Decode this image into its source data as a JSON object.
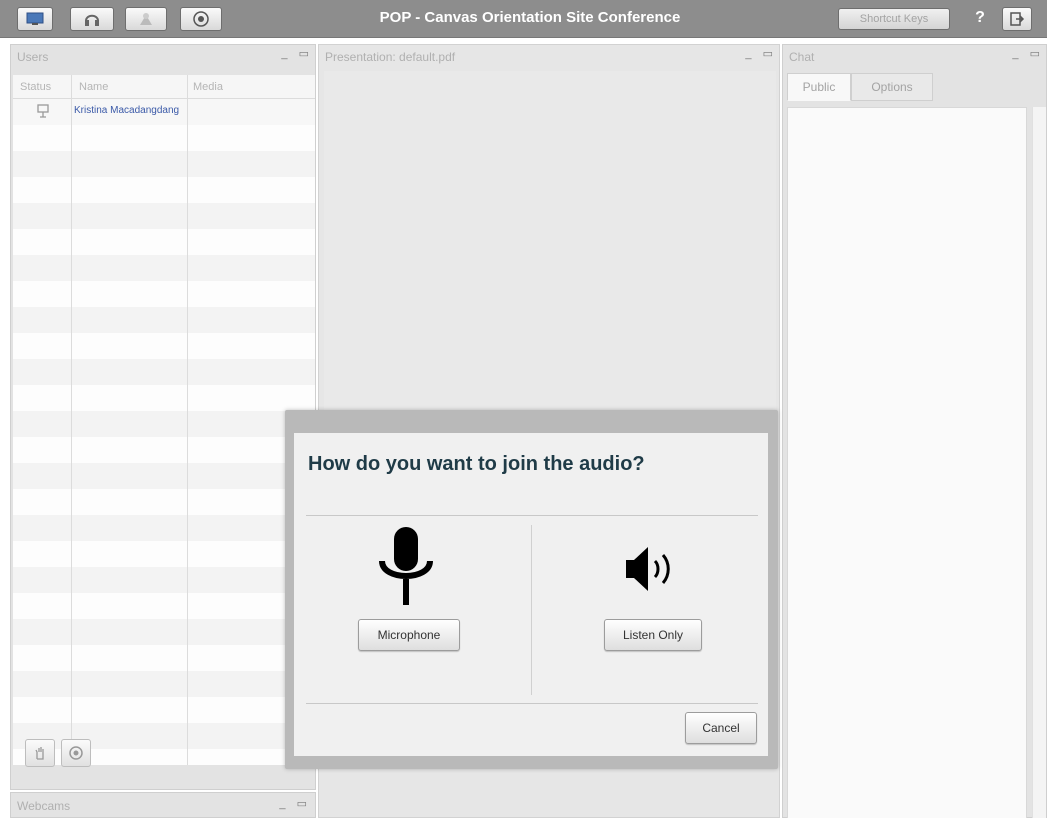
{
  "topbar": {
    "title": "POP - Canvas Orientation Site Conference",
    "shortcut_label": "Shortcut Keys",
    "help_label": "?",
    "icons": [
      "desktop-icon",
      "headset-icon",
      "webcam-icon",
      "record-icon"
    ]
  },
  "users": {
    "title": "Users",
    "columns": [
      "Status",
      "Name",
      "Media"
    ],
    "rows": [
      {
        "status_icon": "presenter-icon",
        "name": "Kristina Macadangdang",
        "media": ""
      }
    ]
  },
  "webcams": {
    "title": "Webcams"
  },
  "presentation": {
    "title": "Presentation: default.pdf"
  },
  "chat": {
    "title": "Chat",
    "tabs": [
      "Public",
      "Options"
    ]
  },
  "audio_modal": {
    "question": "How do you want to join the audio?",
    "microphone_label": "Microphone",
    "listen_label": "Listen Only",
    "cancel_label": "Cancel"
  },
  "colors": {
    "topbar": "#8d8d8d",
    "title_text": "#1f3b47",
    "user_name": "#3b5aa8"
  }
}
